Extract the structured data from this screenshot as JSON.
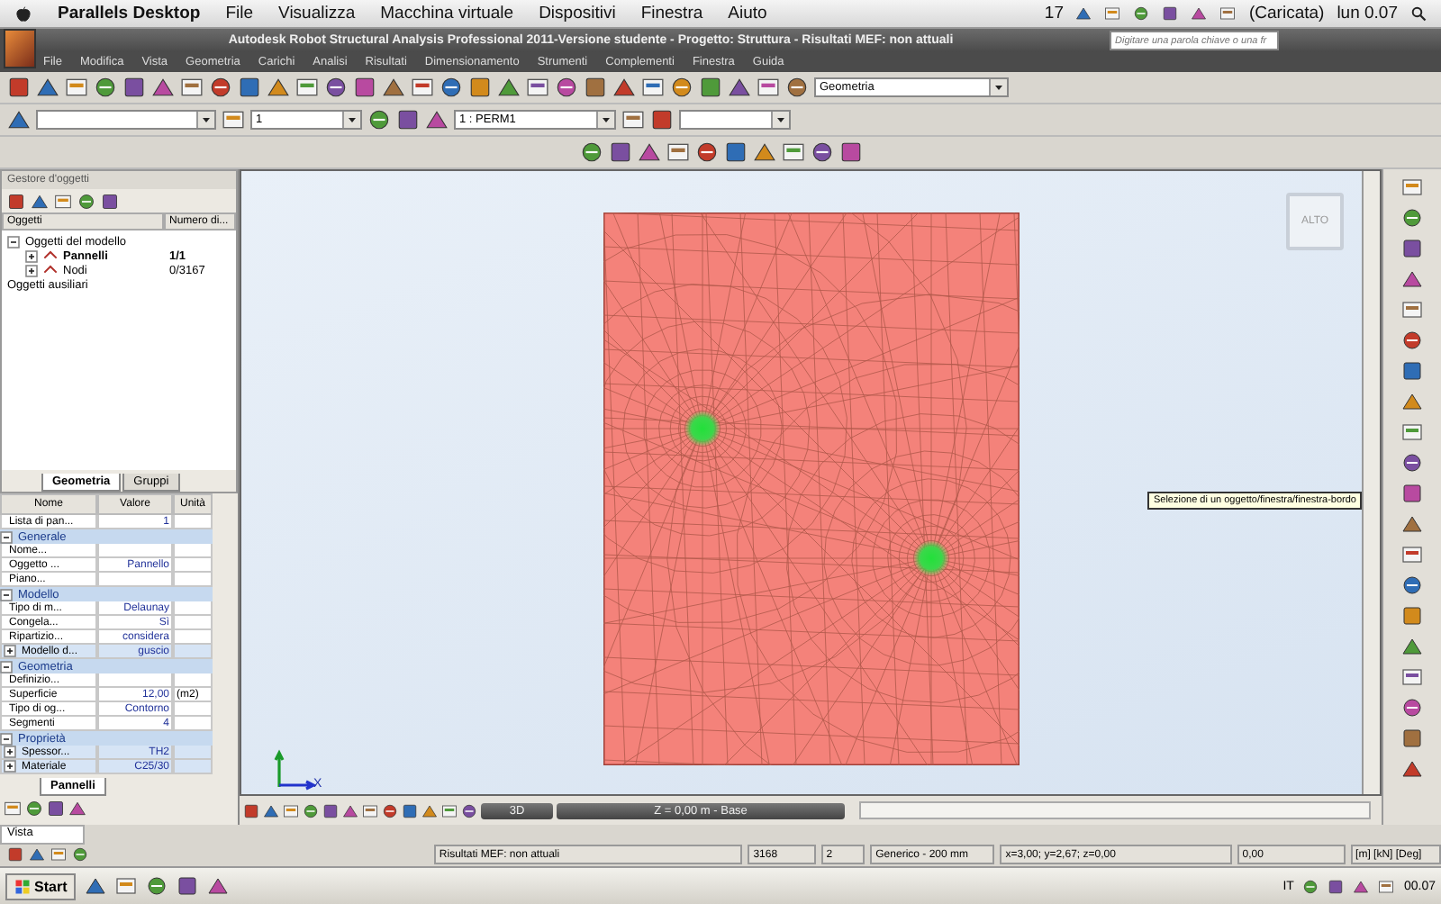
{
  "mac_menu": {
    "items": [
      "Parallels Desktop",
      "File",
      "Visualizza",
      "Macchina virtuale",
      "Dispositivi",
      "Finestra",
      "Aiuto"
    ],
    "status": {
      "badge": "17",
      "battery": "(Caricata)",
      "clock": "lun 0.07"
    }
  },
  "window": {
    "title": "Autodesk Robot Structural Analysis Professional 2011-Versione studente - Progetto: Struttura - Risultati MEF: non attuali",
    "search": {
      "placeholder": "Digitare una parola chiave o una fr"
    }
  },
  "menu": [
    "File",
    "Modifica",
    "Vista",
    "Geometria",
    "Carichi",
    "Analisi",
    "Risultati",
    "Dimensionamento",
    "Strumenti",
    "Complementi",
    "Finestra",
    "Guida"
  ],
  "toolbar": {
    "layout": "Geometria",
    "combo_2": "1",
    "combo_3": "1 : PERM1"
  },
  "object_manager": {
    "title": "Gestore d'oggetti",
    "columns": [
      "Oggetti",
      "Numero di..."
    ],
    "tree": [
      {
        "label": "Oggetti del modello",
        "expanded": true,
        "children": [
          {
            "label": "Pannelli",
            "count": "1/1",
            "expanded": false
          },
          {
            "label": "Nodi",
            "count": "0/3167",
            "expanded": false
          }
        ]
      },
      {
        "label": "Oggetti ausiliari"
      }
    ],
    "tabs": [
      {
        "label": "Geometria",
        "selected": true
      },
      {
        "label": "Gruppi",
        "selected": false
      }
    ]
  },
  "properties": {
    "columns": [
      "Nome",
      "Valore",
      "Unità"
    ],
    "rows": [
      {
        "kind": "row",
        "name": "Lista di pan...",
        "value": "1"
      },
      {
        "kind": "section",
        "name": "Generale",
        "expanded": true
      },
      {
        "kind": "row",
        "name": "Nome..."
      },
      {
        "kind": "row",
        "name": "Oggetto ...",
        "value": "Pannello"
      },
      {
        "kind": "row",
        "name": "Piano..."
      },
      {
        "kind": "section",
        "name": "Modello",
        "expanded": true
      },
      {
        "kind": "row",
        "name": "Tipo di m...",
        "value": "Delaunay"
      },
      {
        "kind": "row",
        "name": "Congela...",
        "value": "Sì"
      },
      {
        "kind": "row",
        "name": "Ripartizio...",
        "value": "considera"
      },
      {
        "kind": "row",
        "name": "Modello d...",
        "value": "guscio",
        "expanded": false
      },
      {
        "kind": "section",
        "name": "Geometria",
        "expanded": true
      },
      {
        "kind": "row",
        "name": "Definizio..."
      },
      {
        "kind": "row",
        "name": "Superficie",
        "value": "12,00",
        "unit": "(m2)"
      },
      {
        "kind": "row",
        "name": "Tipo di og...",
        "value": "Contorno"
      },
      {
        "kind": "row",
        "name": "Segmenti",
        "value": "4"
      },
      {
        "kind": "section",
        "name": "Proprietà",
        "expanded": true
      },
      {
        "kind": "row",
        "name": "Spessor...",
        "value": "TH2",
        "expanded": false
      },
      {
        "kind": "row",
        "name": "Materiale",
        "value": "C25/30",
        "expanded": false
      }
    ],
    "tabs": [
      {
        "label": "Pannelli",
        "selected": true
      }
    ]
  },
  "viewport": {
    "view_cube": "ALTO",
    "tooltip": "Selezione di un oggetto/finestra/finestra-bordo",
    "axis_label": "X",
    "view_mode": "3D",
    "plane": "Z = 0,00 m - Base"
  },
  "vista": "Vista",
  "status_bar": [
    "Risultati MEF: non attuali",
    "3168",
    "2",
    "Generico - 200 mm",
    "x=3,00; y=2,67; z=0,00",
    "0,00",
    "[m] [kN] [Deg]"
  ],
  "taskbar": {
    "start": "Start",
    "language": "IT",
    "clock": "00.07"
  }
}
